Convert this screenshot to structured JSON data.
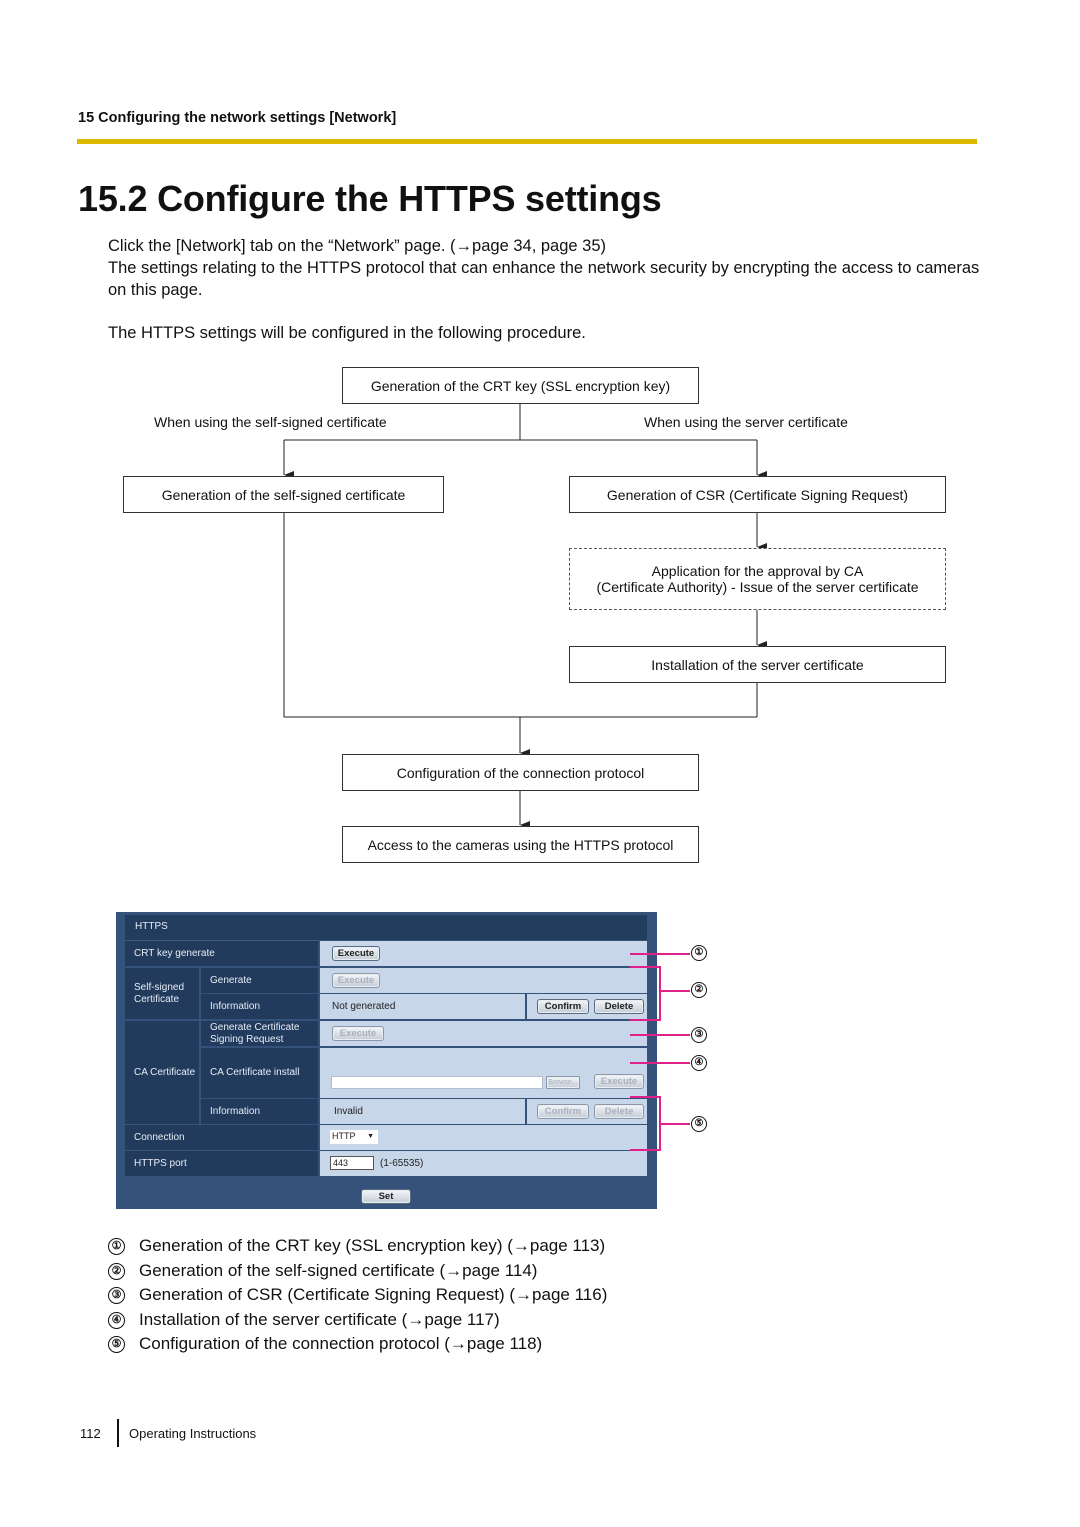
{
  "header": {
    "chapter": "15 Configuring the network settings [Network]",
    "accent_color": "#dcb800"
  },
  "section": {
    "title": "15.2  Configure the HTTPS settings",
    "intro_line1": "Click the [Network] tab on the “Network” page. (→page 34, page 35)",
    "intro_line2": "The settings relating to the HTTPS protocol that can enhance the network security by encrypting the access to cameras on this page.",
    "intro_line3": "The HTTPS settings will be configured in the following procedure."
  },
  "flowchart": {
    "start": "Generation of the CRT key (SSL encryption key)",
    "branch_left_label": "When using the self-signed certificate",
    "branch_right_label": "When using the server certificate",
    "self_signed": "Generation of the self-signed certificate",
    "csr": "Generation of CSR (Certificate Signing Request)",
    "ca_line1": "Application for the approval by CA",
    "ca_line2": "(Certificate Authority) - Issue of the server certificate",
    "install": "Installation of the server certificate",
    "configure": "Configuration of the connection protocol",
    "access": "Access to the cameras using the HTTPS protocol"
  },
  "panel": {
    "header": "HTTPS",
    "crt_label": "CRT key generate",
    "crt_button": "Execute",
    "self_signed_group": "Self-signed Certificate",
    "self_generate_label": "Generate",
    "self_generate_button": "Execute",
    "self_info_label": "Information",
    "self_info_value": "Not generated",
    "self_confirm": "Confirm",
    "self_delete": "Delete",
    "ca_group": "CA Certificate",
    "csr_label": "Generate Certificate Signing Request",
    "csr_button": "Execute",
    "ca_install_label": "CA Certificate install",
    "ca_file_value": "",
    "ca_browse": "Browse...",
    "ca_execute": "Execute",
    "ca_info_label": "Information",
    "ca_info_value": "Invalid",
    "ca_confirm": "Confirm",
    "ca_delete": "Delete",
    "connection_label": "Connection",
    "connection_value": "HTTP",
    "port_label": "HTTPS port",
    "port_value": "443",
    "port_range": "(1-65535)",
    "set_button": "Set"
  },
  "callouts": [
    "①",
    "②",
    "③",
    "④",
    "⑤"
  ],
  "callout_color": "#e0218a",
  "legend": [
    {
      "num": "①",
      "text": "Generation of the CRT key (SSL encryption key) (→page 113)"
    },
    {
      "num": "②",
      "text": "Generation of the self-signed certificate (→page 114)"
    },
    {
      "num": "③",
      "text": "Generation of CSR (Certificate Signing Request) (→page 116)"
    },
    {
      "num": "④",
      "text": "Installation of the server certificate (→page 117)"
    },
    {
      "num": "⑤",
      "text": "Configuration of the connection protocol (→page 118)"
    }
  ],
  "footer": {
    "page_number": "112",
    "doc_title": "Operating Instructions"
  }
}
